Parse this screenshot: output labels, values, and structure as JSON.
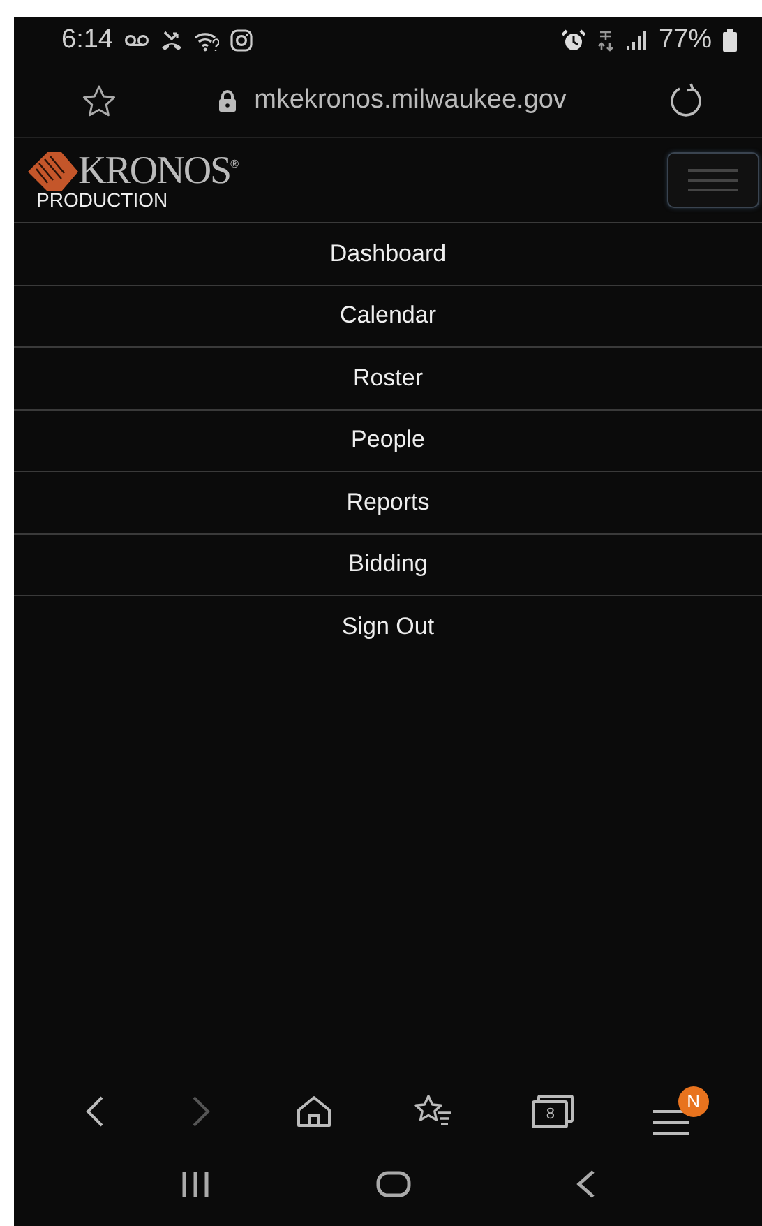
{
  "status_bar": {
    "time": "6:14",
    "battery": "77%"
  },
  "address_bar": {
    "url": "mkekronos.milwaukee.gov"
  },
  "app_header": {
    "logo": "KRONOS",
    "registered_mark": "®",
    "subtitle": "PRODUCTION"
  },
  "menu": [
    {
      "label": "Dashboard"
    },
    {
      "label": "Calendar"
    },
    {
      "label": "Roster"
    },
    {
      "label": "People"
    },
    {
      "label": "Reports"
    },
    {
      "label": "Bidding"
    },
    {
      "label": "Sign Out"
    }
  ],
  "browser_toolbar": {
    "forward_disabled": true,
    "tab_count": "8",
    "menu_badge": "N"
  }
}
